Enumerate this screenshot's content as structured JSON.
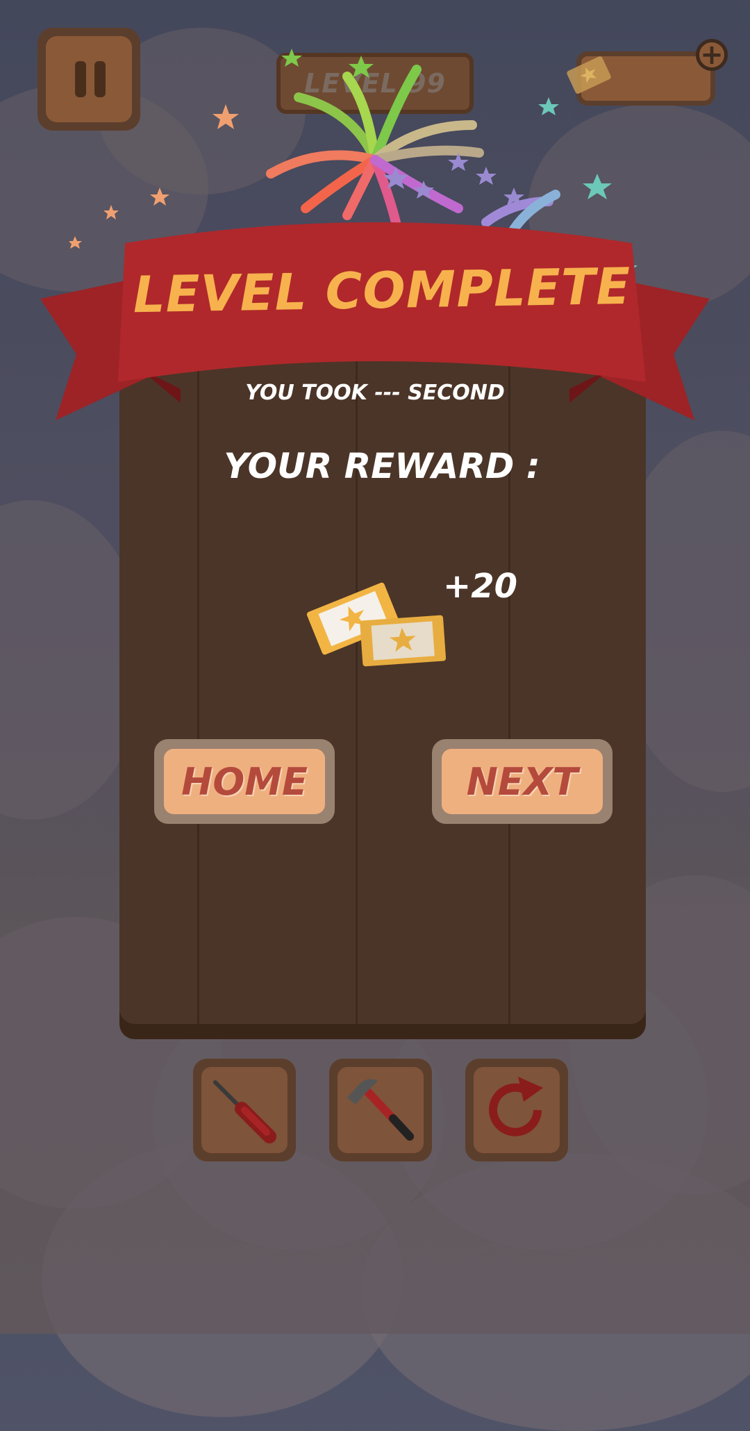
{
  "hud": {
    "level_label": "LEVEL 99",
    "pause_icon": "pause-icon",
    "ticket_icon": "ticket-icon",
    "plus_label": "+"
  },
  "result": {
    "banner_title": "LEVEL COMPLETE",
    "time_text": "YOU TOOK --- SECOND",
    "reward_label": "YOUR REWARD :",
    "reward_amount": "+20"
  },
  "buttons": {
    "home_label": "HOME",
    "next_label": "NEXT"
  },
  "tools": [
    {
      "icon": "screwdriver-icon"
    },
    {
      "icon": "hammer-icon"
    },
    {
      "icon": "restart-icon"
    }
  ],
  "colors": {
    "banner_red": "#b0282b",
    "title_orange": "#f7b24e",
    "button_fill": "#efb080",
    "button_text": "#b44a3c",
    "wood_dark": "#4b3528"
  }
}
